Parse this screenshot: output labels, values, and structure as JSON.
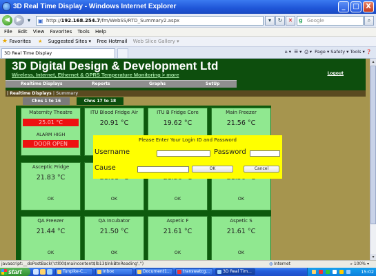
{
  "window": {
    "title": "3D Real Time Display - Windows Internet Explorer",
    "buttons": {
      "minimize": "_",
      "maximize": "□",
      "close": "X"
    }
  },
  "addressbar": {
    "url_prefix": "http://",
    "url_host": "192.168.254.7",
    "url_path": "/fm/WebSS/RTD_Summary2.aspx",
    "search_placeholder": "Google"
  },
  "menubar": {
    "items": [
      "File",
      "Edit",
      "View",
      "Favorites",
      "Tools",
      "Help"
    ]
  },
  "favorites": {
    "label": "Favorites",
    "items": [
      "Suggested Sites ▾",
      "Free Hotmail",
      "Web Slice Gallery ▾"
    ]
  },
  "tabs": {
    "active_tab": "3D Real Time Display",
    "commands": "Page ▾  Safety ▾  Tools ▾"
  },
  "site": {
    "title": "3D Digital Design & Development Ltd",
    "subtitle": "Wireless, Internet, Ethernet & GPRS Temperature Monitoring > more",
    "logout": "Logout",
    "menu": [
      "Realtime Displays",
      "Reports",
      "Graphs",
      "SetUp"
    ],
    "breadcrumb_section": "| Realtime Displays",
    "breadcrumb_page": "| Summary",
    "channel_tabs": [
      "Chns 1 to 16",
      "Chns 17 to 18"
    ]
  },
  "tiles": [
    {
      "name": "Maternity Theatre",
      "value": "25.01 °C",
      "alarm_label": "ALARM HIGH",
      "alarm_status": "DOOR OPEN"
    },
    {
      "name": "ITU Blood Fridge Air",
      "value": "20.91 °C",
      "status": ""
    },
    {
      "name": "ITU B Fridge Core",
      "value": "19.62 °C",
      "status": ""
    },
    {
      "name": "Main Freezer",
      "value": "21.56 °C",
      "status": ""
    },
    {
      "name": "Asceptic Fridge",
      "value": "21.83 °C",
      "status": "OK"
    },
    {
      "name": "",
      "value": "21.61 °C",
      "status": "OK"
    },
    {
      "name": "",
      "value": "21.56 °C",
      "status": "OK"
    },
    {
      "name": "",
      "value": "21.56 °C",
      "status": "OK"
    },
    {
      "name": "QA Freezer",
      "value": "21.44 °C",
      "status": "OK"
    },
    {
      "name": "QA Incubator",
      "value": "21.50 °C",
      "status": "OK"
    },
    {
      "name": "Aspetic F",
      "value": "21.61 °C",
      "status": "OK"
    },
    {
      "name": "Aspetic S",
      "value": "21.61 °C",
      "status": "OK"
    }
  ],
  "login": {
    "prompt": "Please Enter Your Login ID and Password",
    "username_label": "Username",
    "password_label": "Password",
    "cause_label": "Cause",
    "ok_label": "OK",
    "cancel_label": "Cancel"
  },
  "statusbar": {
    "text": "javascript:__doPostBack('ctl00$maincontent$lb13$lnkBtnReading','')",
    "zone": "Internet",
    "zoom": "100%"
  },
  "taskbar": {
    "start_label": "start",
    "tasks": [
      "Tunpike-C...",
      "Inbox",
      "Document1...",
      "transwatcg...",
      "3D Real Tim..."
    ],
    "clock": "15:02"
  }
}
